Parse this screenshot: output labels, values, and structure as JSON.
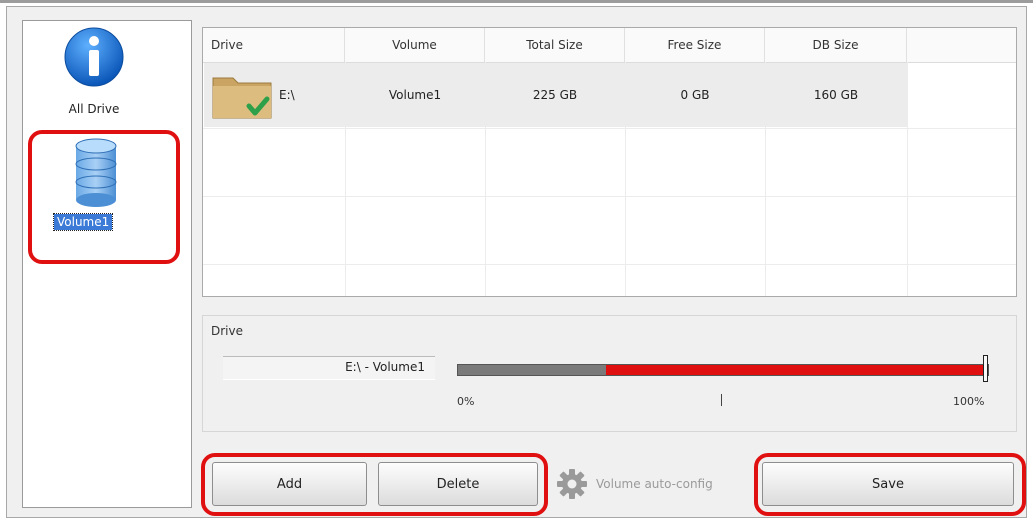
{
  "sidebar": {
    "items": [
      {
        "label": "All Drive",
        "icon": "info-icon"
      },
      {
        "label": "Volume1",
        "icon": "database-icon",
        "selected": true
      }
    ]
  },
  "grid": {
    "columns": [
      "Drive",
      "Volume",
      "Total Size",
      "Free Size",
      "DB Size"
    ],
    "rows": [
      {
        "drive": "E:\\",
        "volume": "Volume1",
        "total_size": "225 GB",
        "free_size": "0 GB",
        "db_size": "160 GB",
        "icon": "folder-check-icon"
      }
    ]
  },
  "drive_panel": {
    "title": "Drive",
    "name": "E:\\ - Volume1",
    "usage_percent": 72,
    "min_label": "0%",
    "max_label": "100%"
  },
  "buttons": {
    "add": "Add",
    "delete": "Delete",
    "auto_config": "Volume auto-config",
    "save": "Save"
  },
  "colors": {
    "highlight": "#e01010",
    "usage_bar": "#e01010",
    "selection": "#3b7bd7"
  }
}
